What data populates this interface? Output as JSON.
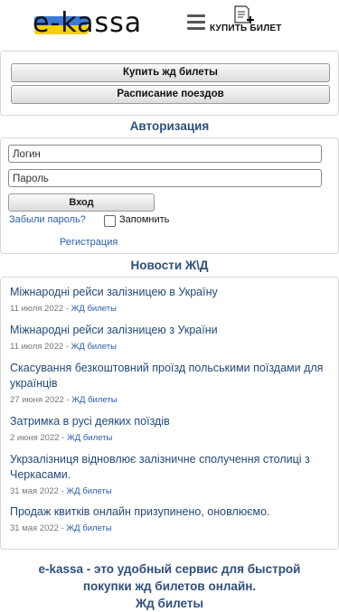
{
  "header": {
    "logo_text": "e-kassa",
    "buy_ticket_label": "КУПИТЬ БИЛЕТ"
  },
  "actions": {
    "buy_train_tickets": "Купить жд билеты",
    "train_schedule": "Расписание поездов"
  },
  "auth": {
    "title": "Авторизация",
    "login_placeholder": "Логин",
    "password_placeholder": "Пароль",
    "login_button": "Вход",
    "forgot_password": "Забыли пароль?",
    "remember_me": "Запомнить",
    "register": "Регистрация"
  },
  "news": {
    "title": "Новости Ж\\Д",
    "items": [
      {
        "title": "Міжнародні рейси залізницею в Україну",
        "date": "11 июля 2022",
        "category": "ЖД билеты"
      },
      {
        "title": "Міжнародні рейси залізницею з України",
        "date": "11 июля 2022",
        "category": "ЖД билеты"
      },
      {
        "title": "Скасування безкоштовний проїзд польськими поїздами для українців",
        "date": "27 июня 2022",
        "category": "ЖД билеты"
      },
      {
        "title": "Затримка в русі деяких поїздів",
        "date": "2 июня 2022",
        "category": "ЖД билеты"
      },
      {
        "title": "Укрзалізниця відновлює залізничне сполучення столиці з Черкасами.",
        "date": "31 мая 2022",
        "category": "ЖД билеты"
      },
      {
        "title": "Продаж квитків онлайн призупинено, оновлюємо.",
        "date": "31 мая 2022",
        "category": "ЖД билеты"
      }
    ]
  },
  "promo": {
    "line1": "e-kassa - это удобный сервис для быстрой",
    "line2": "покупки жд билетов онлайн.",
    "line3": "Жд билеты"
  },
  "colors": {
    "accent": "#2e4f7c",
    "link": "#2a5db0",
    "flag_blue": "#3a7bd5",
    "flag_yellow": "#f5d000"
  }
}
